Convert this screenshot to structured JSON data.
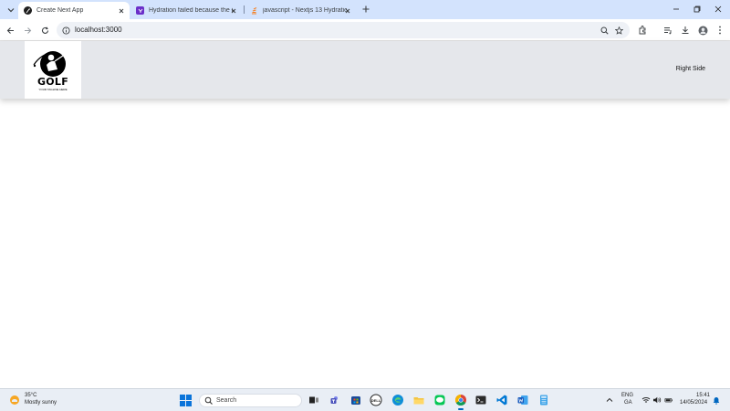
{
  "browser": {
    "tabs": [
      {
        "title": "Create Next App",
        "active": true
      },
      {
        "title": "Hydration failed because the in",
        "active": false
      },
      {
        "title": "javascript - Nextjs 13 Hydration",
        "active": false
      }
    ],
    "url": "localhost:3000",
    "icons": {
      "tab_search": "chevron-down-icon",
      "new_tab": "plus-icon",
      "back": "back-arrow-icon",
      "forward": "forward-arrow-icon",
      "reload": "reload-icon",
      "info": "info-icon",
      "zoom": "zoom-icon",
      "bookmark": "star-icon",
      "extensions": "puzzle-icon",
      "media": "media-controls-icon",
      "downloads": "download-icon",
      "profile": "avatar-icon",
      "menu": "kebab-menu-icon"
    }
  },
  "page": {
    "logo_text": "GOLF",
    "logo_subtext": "YOUR TAGLINE HERE",
    "right_side": "Right Side",
    "navbar_color": "#e5e7eb"
  },
  "taskbar": {
    "weather_temp": "35°C",
    "weather_desc": "Mostly sunny",
    "search_label": "Search",
    "lang_line1": "ENG",
    "lang_line2": "GA",
    "time": "15:41",
    "date": "14/05/2024",
    "apps": [
      "task-view-icon",
      "teams-icon",
      "store-icon",
      "dell-icon",
      "edge-icon",
      "file-explorer-icon",
      "line-icon",
      "chrome-icon",
      "terminal-icon",
      "vscode-icon",
      "word-icon",
      "calculator-icon"
    ]
  }
}
